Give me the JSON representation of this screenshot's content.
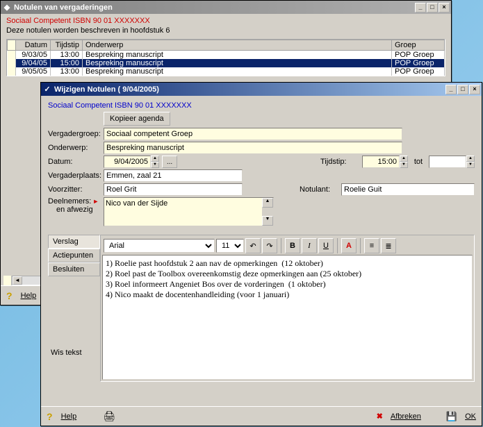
{
  "bgWindow": {
    "title": "Notulen van vergaderingen",
    "heading": "Sociaal Competent ISBN 90 01 XXXXXXX",
    "description": "Deze notulen worden beschreven in  hoofdstuk 6",
    "columns": {
      "datum": "Datum",
      "tijdstip": "Tijdstip",
      "onderwerp": "Onderwerp",
      "groep": "Groep"
    },
    "rows": [
      {
        "datum": "9/03/05",
        "tijdstip": "13:00",
        "onderwerp": "Bespreking manuscript",
        "groep": "POP Groep",
        "selected": false
      },
      {
        "datum": "9/04/05",
        "tijdstip": "15:00",
        "onderwerp": "Bespreking manuscript",
        "groep": "POP Groep",
        "selected": true
      },
      {
        "datum": "9/05/05",
        "tijdstip": "13:00",
        "onderwerp": "Bespreking manuscript",
        "groep": "POP Groep",
        "selected": false
      }
    ],
    "helpLabel": "Help"
  },
  "dlg": {
    "title": "Wijzigen Notulen  ( 9/04/2005)",
    "heading": "Sociaal Competent ISBN 90 01 XXXXXXX",
    "copyAgendaBtn": "Kopieer agenda",
    "labels": {
      "vergadergroep": "Vergadergroep:",
      "onderwerp": "Onderwerp:",
      "datum": "Datum:",
      "tijdstip": "Tijdstip:",
      "tot": "tot",
      "vergaderplaats": "Vergaderplaats:",
      "voorzitter": "Voorzitter:",
      "notulant": "Notulant:",
      "deelnemers": "Deelnemers:",
      "enAfwezig": "en afwezig",
      "wisTekst": "Wis tekst"
    },
    "values": {
      "vergadergroep": "Sociaal competent Groep",
      "onderwerp": "Bespreking manuscript",
      "datum": "9/04/2005",
      "tijdstip": "15:00",
      "tot": "",
      "vergaderplaats": "Emmen, zaal 21",
      "voorzitter": "Roel Grit",
      "notulant": "Roelie Guit",
      "deelnemers": "Nico van der Sijde"
    },
    "tabs": {
      "verslag": "Verslag",
      "actiepunten": "Actiepunten",
      "besluiten": "Besluiten"
    },
    "toolbar": {
      "font": "Arial",
      "size": "11"
    },
    "body": "1) Roelie past hoofdstuk 2 aan nav de opmerkingen  (12 oktober)\n2) Roel past de Toolbox overeenkomstig deze opmerkingen aan (25 oktober)\n3) Roel informeert Angeniet Bos over de vorderingen  (1 oktober)\n4) Nico maakt de docentenhandleiding (voor 1 januari)",
    "footer": {
      "help": "Help",
      "afbreken": "Afbreken",
      "ok": "OK"
    }
  }
}
